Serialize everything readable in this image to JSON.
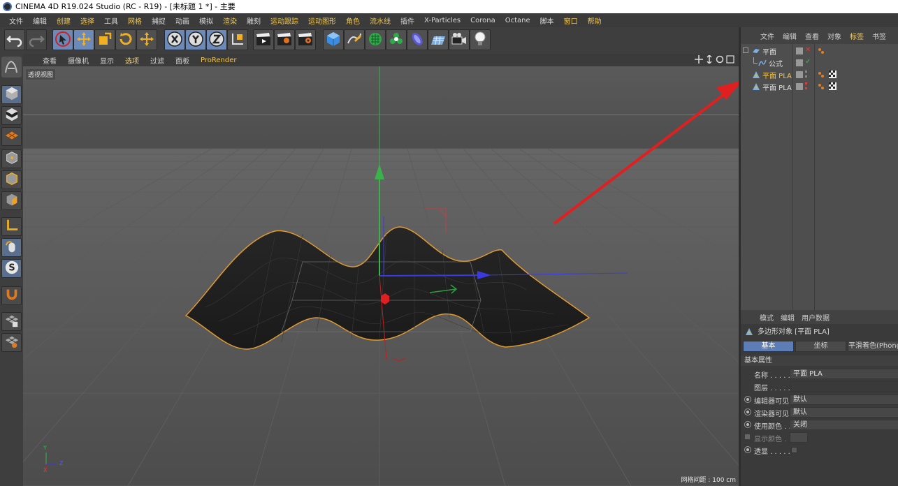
{
  "window": {
    "title": "CINEMA 4D R19.024 Studio (RC - R19) - [未标题 1 *] - 主要"
  },
  "menubar": {
    "items": [
      "文件",
      "编辑",
      "创建",
      "选择",
      "工具",
      "网格",
      "捕捉",
      "动画",
      "模拟",
      "渲染",
      "雕刻",
      "运动跟踪",
      "运动图形",
      "角色",
      "流水线",
      "插件",
      "X-Particles",
      "Corona",
      "Octane",
      "脚本",
      "窗口",
      "帮助"
    ]
  },
  "viewport": {
    "menu": [
      "查看",
      "摄像机",
      "显示",
      "选项",
      "过滤",
      "面板",
      "ProRender"
    ],
    "view_name": "透视视图",
    "grid_spacing": "网格间距 : 100 cm",
    "axis_labels": {
      "y": "Y",
      "z": "Z",
      "x": "X"
    }
  },
  "object_manager": {
    "menu": [
      "文件",
      "编辑",
      "查看",
      "对象",
      "标签",
      "书签"
    ],
    "objects": [
      {
        "name": "平面",
        "state": "normal"
      },
      {
        "name": "公式",
        "state": "normal"
      },
      {
        "name": "平面 PLA",
        "state": "selected"
      },
      {
        "name": "平面 PLA",
        "state": "normal"
      }
    ]
  },
  "attribute_manager": {
    "menu": [
      "模式",
      "编辑",
      "用户数据"
    ],
    "object_title": "多边形对象 [平面 PLA]",
    "tabs": [
      "基本",
      "坐标",
      "平滑着色(Phong)"
    ],
    "section": "基本属性",
    "fields": [
      {
        "label": "名称 . . . . .",
        "value": "平面 PLA"
      },
      {
        "label": "图层 . . . . .",
        "value": ""
      },
      {
        "label": "编辑器可见",
        "value": "默认"
      },
      {
        "label": "渲染器可见",
        "value": "默认"
      },
      {
        "label": "使用颜色 . .",
        "value": "关闭"
      },
      {
        "label": "显示颜色 .",
        "value": ""
      },
      {
        "label": "透显 . . . . .",
        "value": ""
      }
    ]
  },
  "colors": {
    "accent_yellow": "#f0c64a",
    "selection_blue": "#5c7db5",
    "annotation_arrow": "#e02020",
    "mesh_outline": "#e09a30"
  }
}
